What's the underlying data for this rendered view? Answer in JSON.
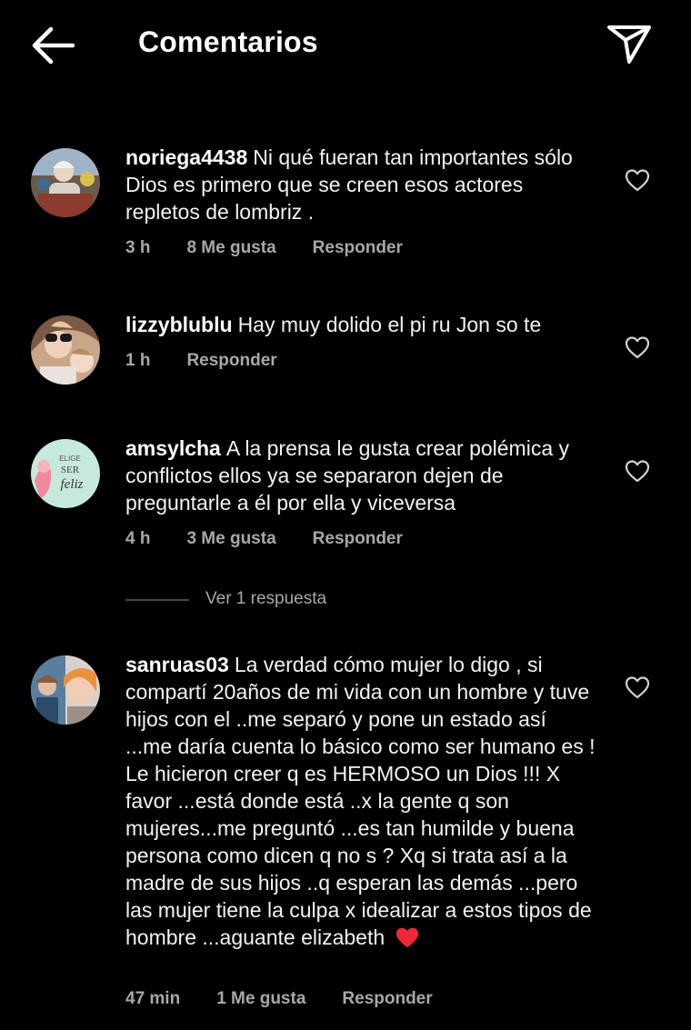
{
  "header": {
    "title": "Comentarios",
    "back_icon": "arrow-left-icon",
    "share_icon": "paper-plane-icon"
  },
  "comments": [
    {
      "username": "noriega4438",
      "text": "Ni qué fueran tan importantes sólo Dios es primero que se creen esos actores repletos de lombriz .",
      "time": "3 h",
      "likes": "8 Me gusta",
      "reply": "Responder"
    },
    {
      "username": "lizzyblublu",
      "text": "Hay muy dolido el pi ru Jon so te",
      "time": "1 h",
      "likes": "",
      "reply": "Responder"
    },
    {
      "username": "amsylcha",
      "text": "A la prensa le gusta crear polémica y conflictos ellos ya se separaron dejen de preguntarle a él por ella y viceversa",
      "time": "4 h",
      "likes": "3 Me gusta",
      "reply": "Responder",
      "view_replies": "Ver 1 respuesta",
      "avatar_text": [
        "ELIGE",
        "SER",
        "feliz"
      ]
    },
    {
      "username": "sanruas03",
      "text": "La verdad cómo mujer lo digo , si compartí 20años de mi vida con un hombre y tuve hijos con el ..me separó y pone un estado así ...me daría cuenta lo básico como ser humano es ! Le hicieron creer q es HERMOSO  un Dios !!! X favor ...está donde está ..x la gente q son mujeres...me preguntó ...es tan humilde y buena persona como dicen q no s ? Xq si trata así a la madre de sus hijos ..q esperan las demás ...pero las mujer tiene la culpa x idealizar a estos tipos de hombre ...aguante elizabeth",
      "emoji": "red-heart-icon",
      "time": "47 min",
      "likes": "1 Me gusta",
      "reply": "Responder"
    }
  ],
  "colors": {
    "background": "#000000",
    "text": "#f5f5f5",
    "secondary": "#a8a8a8",
    "heart": "#ed4956"
  }
}
